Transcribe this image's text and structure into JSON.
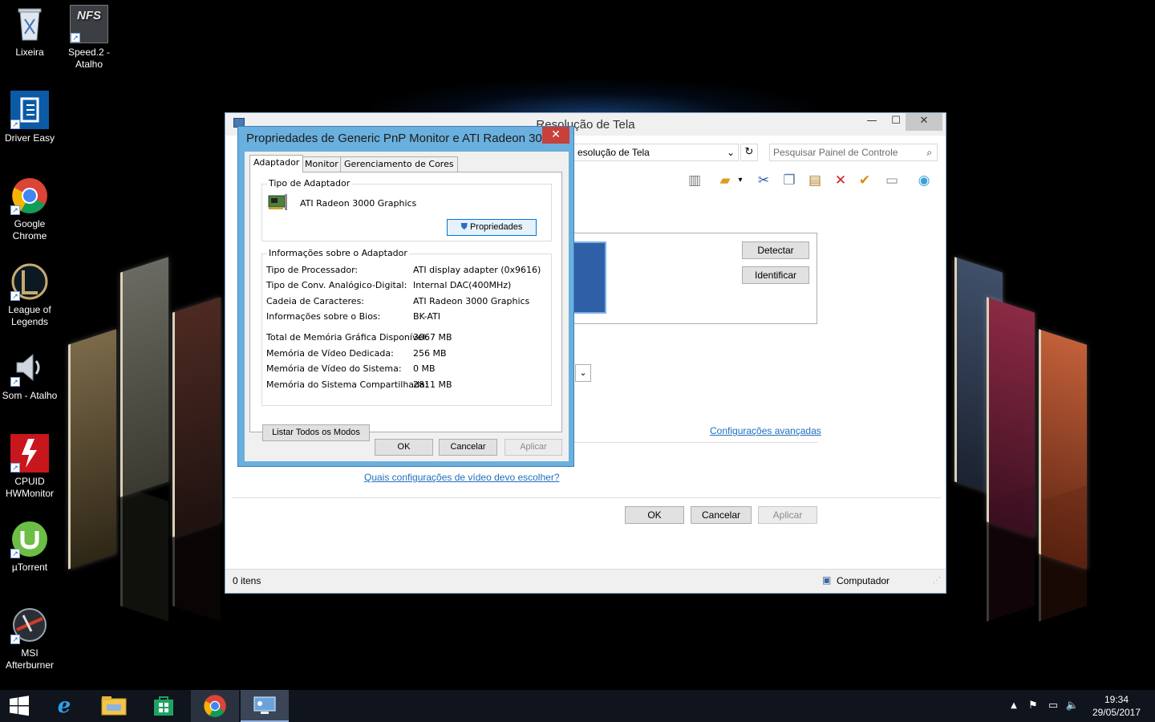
{
  "desktop": {
    "icons": [
      {
        "label": "Lixeira",
        "icon": "recycle-bin-icon"
      },
      {
        "label": "Speed.2 - Atalho",
        "icon": "nfs-game-icon",
        "badge": "NFS"
      },
      {
        "label": "Driver Easy",
        "icon": "driver-easy-icon"
      },
      {
        "label": "Google Chrome",
        "icon": "chrome-icon"
      },
      {
        "label": "League of Legends",
        "icon": "league-of-legends-icon"
      },
      {
        "label": "Som - Atalho",
        "icon": "speaker-icon"
      },
      {
        "label": "CPUID HWMonitor",
        "icon": "hwmonitor-icon"
      },
      {
        "label": "µTorrent",
        "icon": "utorrent-icon"
      },
      {
        "label": "MSI Afterburner",
        "icon": "afterburner-icon"
      }
    ]
  },
  "control_panel": {
    "title": "Resolução de Tela",
    "address": "esolução de Tela",
    "search_placeholder": "Pesquisar Painel de Controle",
    "detect_label": "Detectar",
    "identify_label": "Identificar",
    "advanced_link": "Configurações avançadas",
    "help_link": "Quais configurações de vídeo devo escolher?",
    "ok_label": "OK",
    "cancel_label": "Cancelar",
    "apply_label": "Aplicar",
    "status_items": "0 itens",
    "status_computer": "Computador"
  },
  "dialog": {
    "title": "Propriedades de Generic PnP Monitor e ATI Radeon 30...",
    "tabs": [
      "Adaptador",
      "Monitor",
      "Gerenciamento de Cores"
    ],
    "adapter_type_legend": "Tipo de Adaptador",
    "adapter_name": "ATI Radeon 3000 Graphics",
    "properties_label": "Propriedades",
    "info_legend": "Informações sobre o Adaptador",
    "info": [
      {
        "label": "Tipo de Processador:",
        "value": "ATI display adapter (0x9616)"
      },
      {
        "label": "Tipo de Conv. Analógico-Digital:",
        "value": "Internal DAC(400MHz)"
      },
      {
        "label": "Cadeia de Caracteres:",
        "value": "ATI Radeon 3000 Graphics"
      },
      {
        "label": "Informações sobre o Bios:",
        "value": "BK-ATI"
      }
    ],
    "memory": [
      {
        "label": "Total de Memória Gráfica Disponível:",
        "value": "3067 MB"
      },
      {
        "label": "Memória de Vídeo Dedicada:",
        "value": "256 MB"
      },
      {
        "label": "Memória de Vídeo do Sistema:",
        "value": "0 MB"
      },
      {
        "label": "Memória do Sistema Compartilhada:",
        "value": "2811 MB"
      }
    ],
    "list_modes_label": "Listar Todos os Modos",
    "ok_label": "OK",
    "cancel_label": "Cancelar",
    "apply_label": "Aplicar"
  },
  "taskbar": {
    "time": "19:34",
    "date": "29/05/2017",
    "accent": "#3a4658"
  }
}
